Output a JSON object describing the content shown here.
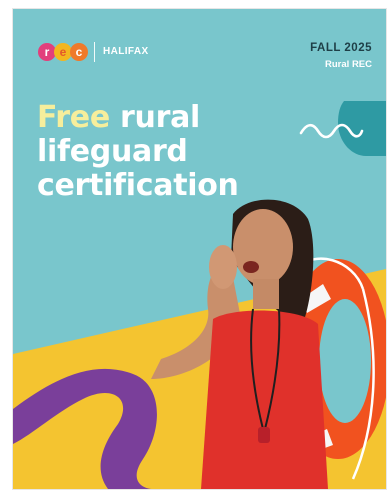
{
  "brand": {
    "rec_letters": [
      "r",
      "e",
      "c"
    ],
    "city": "HALIFAX"
  },
  "season": {
    "term": "FALL 2025",
    "program": "Rural REC"
  },
  "headline": {
    "highlight": "Free",
    "line1_rest": " rural",
    "line2": "lifeguard",
    "line3": "certification"
  },
  "colors": {
    "background": "#79c6cc",
    "headline_highlight": "#f6ee9c",
    "yellow_band": "#f4c430",
    "purple_swoosh": "#7a3f9a",
    "swimsuit": "#e0312b",
    "lifebuoy": "#f1521f"
  },
  "icons": {
    "logo": "rec-logo",
    "wave": "wave-icon",
    "whistle": "whistle-icon"
  }
}
